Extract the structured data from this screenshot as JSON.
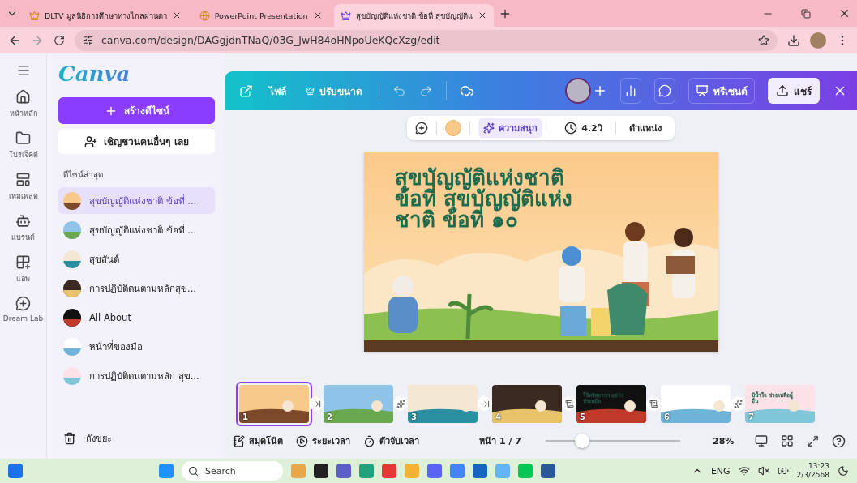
{
  "browser": {
    "tabs": [
      {
        "title": "DLTV มูลนิธิการศึกษาทางไกลผ่านดา",
        "selected": false
      },
      {
        "title": "PowerPoint Presentation",
        "selected": false
      },
      {
        "title": "สุขบัญญัติแห่งชาติ ข้อที่ สุขบัญญัติแ",
        "selected": true
      }
    ],
    "url": "canva.com/design/DAGgjdnTNaQ/03G_JwH84oHNpoUeKQcXzg/edit"
  },
  "rail": [
    {
      "label": "หน้าหลัก"
    },
    {
      "label": "โปรเจ็คต์"
    },
    {
      "label": "เทมเพลต"
    },
    {
      "label": "แบรนด์"
    },
    {
      "label": "แอพ"
    },
    {
      "label": "Dream Lab"
    }
  ],
  "sidebar": {
    "logo": "Canva",
    "create_button": "สร้างดีไซน์",
    "invite_button": "เชิญชวนคนอื่นๆ เลย",
    "recent_heading": "ดีไซน์ล่าสุด",
    "recent": [
      {
        "title": "สุขบัญญัติแห่งชาติ ข้อที่ ...",
        "selected": true
      },
      {
        "title": "สุขบัญญัติแห่งชาติ ข้อที่ ...",
        "selected": false
      },
      {
        "title": "สุขสันต์",
        "selected": false
      },
      {
        "title": "การปฏิบัติตนตามหลักสุข...",
        "selected": false
      },
      {
        "title": "All About",
        "selected": false
      },
      {
        "title": "หน้าที่ของมือ",
        "selected": false
      },
      {
        "title": "การปฏิบัติตนตามหลัก สุข...",
        "selected": false
      }
    ],
    "trash": "ถังขยะ"
  },
  "toolbar": {
    "file": "ไฟล์",
    "resize": "ปรับขนาด",
    "present": "พรีเซนต์",
    "share": "แชร์"
  },
  "context_bar": {
    "animate": "ความสนุก",
    "animate_selected": true,
    "duration": "4.2วิ",
    "position": "ตำแหน่ง"
  },
  "slide": {
    "title": "สุขบัญญัติแห่งชาติ ข้อที่ สุขบัญญัติแห่งชาติ ข้อที่ ๑๐"
  },
  "filmstrip": [
    {
      "number": "1",
      "selected": true
    },
    {
      "number": "2",
      "selected": false
    },
    {
      "number": "3",
      "selected": false
    },
    {
      "number": "4",
      "selected": false
    },
    {
      "number": "5",
      "selected": false,
      "title": "ใช้ทรัพยากร อย่างประหยัด"
    },
    {
      "number": "6",
      "selected": false
    },
    {
      "number": "7",
      "selected": false,
      "title": "มีน้ำใจ ช่วยเหลือผู้อื่น"
    }
  ],
  "footer": {
    "notes": "สมุดโน้ต",
    "duration": "ระยะเวลา",
    "timer": "ตัวจับเวลา",
    "page": "หน้า 1 / 7",
    "zoom": {
      "level": 0.27,
      "reading": "28%"
    }
  },
  "taskbar": {
    "search": "Search",
    "language": "ENG",
    "time": "13:23",
    "date": "2/3/2568"
  }
}
